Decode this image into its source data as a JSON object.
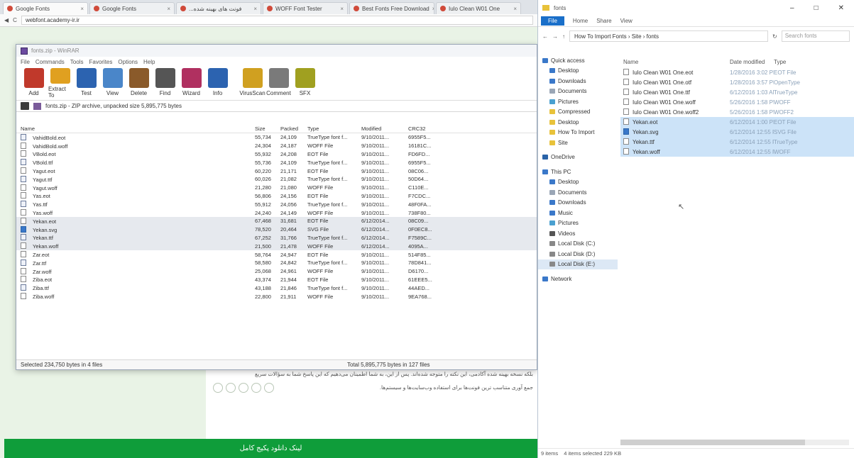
{
  "browser": {
    "tabs": [
      "Google Fonts",
      "Google Fonts",
      "...فونت های بهینه شده",
      "WOFF Font Tester",
      "Best Fonts Free Download",
      "Iulo Clean W01 One"
    ],
    "url": "webfont.academy-ir.ir",
    "rtl_line1": "بلکه نسخه بهینه شده آکادمی، این نکته را متوجه شده‌اند. پس از این، به شما اطمینان می‌دهیم که این پاسخ شما به سؤالات سریع",
    "rtl_line2": "جمع آوری متناسب ترین فونت‌ها برای استفاده وب‌سایت‌ها و سیستم‌ها.",
    "greenbar_text": "لینک دانلود پکیج کامل"
  },
  "winrar": {
    "title": "fonts.zip - WinRAR",
    "menu": [
      "File",
      "Commands",
      "Tools",
      "Favorites",
      "Options",
      "Help"
    ],
    "toolbar": [
      {
        "label": "Add",
        "icon": "add-icon",
        "color": "#c0392b"
      },
      {
        "label": "Extract To",
        "icon": "extract-icon",
        "color": "#e0a020"
      },
      {
        "label": "Test",
        "icon": "test-icon",
        "color": "#2c63b0"
      },
      {
        "label": "View",
        "icon": "view-icon",
        "color": "#4a86c9"
      },
      {
        "label": "Delete",
        "icon": "delete-icon",
        "color": "#8a5a2a"
      },
      {
        "label": "Find",
        "icon": "find-icon",
        "color": "#555555"
      },
      {
        "label": "Wizard",
        "icon": "wizard-icon",
        "color": "#b03060"
      },
      {
        "label": "Info",
        "icon": "info-icon",
        "color": "#2c63b0"
      },
      {
        "label": "VirusScan",
        "icon": "virusscan-icon",
        "color": "#d0a020"
      },
      {
        "label": "Comment",
        "icon": "comment-icon",
        "color": "#7a7a7a"
      },
      {
        "label": "SFX",
        "icon": "sfx-icon",
        "color": "#a0a020"
      }
    ],
    "path": "fonts.zip - ZIP archive, unpacked size 5,895,775 bytes",
    "columns": [
      "Name",
      "Size",
      "Packed",
      "Type",
      "Modified",
      "CRC32"
    ],
    "rows": [
      {
        "name": "VahidBold.eot",
        "size": "55,734",
        "packed": "24,109",
        "type": "TrueType font f...",
        "mod": "9/10/2011...",
        "crc": "6955F5...",
        "icon": "ttf"
      },
      {
        "name": "VahidBold.woff",
        "size": "24,304",
        "packed": "24,187",
        "type": "WOFF File",
        "mod": "9/10/2011...",
        "crc": "16181C...",
        "icon": "file"
      },
      {
        "name": "VBold.eot",
        "size": "55,932",
        "packed": "24,208",
        "type": "EOT File",
        "mod": "9/10/2011...",
        "crc": "FD6FD...",
        "icon": "file"
      },
      {
        "name": "VBold.ttf",
        "size": "55,736",
        "packed": "24,109",
        "type": "TrueType font f...",
        "mod": "9/10/2011...",
        "crc": "6955F5...",
        "icon": "ttf"
      },
      {
        "name": "Yagut.eot",
        "size": "60,220",
        "packed": "21,171",
        "type": "EOT File",
        "mod": "9/10/2011...",
        "crc": "08C06...",
        "icon": "file"
      },
      {
        "name": "Yagut.ttf",
        "size": "60,026",
        "packed": "21,082",
        "type": "TrueType font f...",
        "mod": "9/10/2011...",
        "crc": "50D64...",
        "icon": "ttf"
      },
      {
        "name": "Yagut.woff",
        "size": "21,280",
        "packed": "21,080",
        "type": "WOFF File",
        "mod": "9/10/2011...",
        "crc": "C110E...",
        "icon": "file"
      },
      {
        "name": "Yas.eot",
        "size": "56,806",
        "packed": "24,156",
        "type": "EOT File",
        "mod": "9/10/2011...",
        "crc": "F7CDC...",
        "icon": "file"
      },
      {
        "name": "Yas.ttf",
        "size": "55,912",
        "packed": "24,056",
        "type": "TrueType font f...",
        "mod": "9/10/2011...",
        "crc": "48F0FA...",
        "icon": "ttf"
      },
      {
        "name": "Yas.woff",
        "size": "24,240",
        "packed": "24,149",
        "type": "WOFF File",
        "mod": "9/10/2011...",
        "crc": "738F80...",
        "icon": "file"
      },
      {
        "name": "Yekan.eot",
        "size": "67,468",
        "packed": "31,681",
        "type": "EOT File",
        "mod": "6/12/2014...",
        "crc": "08C09...",
        "icon": "file",
        "selected": true
      },
      {
        "name": "Yekan.svg",
        "size": "78,520",
        "packed": "20,464",
        "type": "SVG File",
        "mod": "6/12/2014...",
        "crc": "0F0EC8...",
        "icon": "svg",
        "selected": true
      },
      {
        "name": "Yekan.ttf",
        "size": "67,252",
        "packed": "31,766",
        "type": "TrueType font f...",
        "mod": "6/12/2014...",
        "crc": "F7589C...",
        "icon": "ttf",
        "selected": true
      },
      {
        "name": "Yekan.woff",
        "size": "21,500",
        "packed": "21,478",
        "type": "WOFF File",
        "mod": "6/12/2014...",
        "crc": "4095A...",
        "icon": "file",
        "selected": true
      },
      {
        "name": "Zar.eot",
        "size": "58,764",
        "packed": "24,947",
        "type": "EOT File",
        "mod": "9/10/2011...",
        "crc": "514F85...",
        "icon": "file"
      },
      {
        "name": "Zar.ttf",
        "size": "58,580",
        "packed": "24,842",
        "type": "TrueType font f...",
        "mod": "9/10/2011...",
        "crc": "78D841...",
        "icon": "ttf"
      },
      {
        "name": "Zar.woff",
        "size": "25,068",
        "packed": "24,961",
        "type": "WOFF File",
        "mod": "9/10/2011...",
        "crc": "D6170...",
        "icon": "file"
      },
      {
        "name": "Ziba.eot",
        "size": "43,374",
        "packed": "21,944",
        "type": "EOT File",
        "mod": "9/10/2011...",
        "crc": "61EEE5...",
        "icon": "file"
      },
      {
        "name": "Ziba.ttf",
        "size": "43,188",
        "packed": "21,846",
        "type": "TrueType font f...",
        "mod": "9/10/2011...",
        "crc": "44AED...",
        "icon": "ttf"
      },
      {
        "name": "Ziba.woff",
        "size": "22,800",
        "packed": "21,911",
        "type": "WOFF File",
        "mod": "9/10/2011...",
        "crc": "9EA768...",
        "icon": "file"
      }
    ],
    "status_left": "Selected 234,750 bytes in 4 files",
    "status_right": "Total 5,895,775 bytes in 127 files"
  },
  "explorer": {
    "title": "fonts",
    "ribbon": [
      "File",
      "Home",
      "Share",
      "View"
    ],
    "breadcrumb": "How To Import Fonts  ›  Site  ›  fonts",
    "search_placeholder": "Search fonts",
    "nav": [
      {
        "label": "Quick access",
        "top": true,
        "color": "#3a78c9"
      },
      {
        "label": "Desktop",
        "color": "#3a78c9"
      },
      {
        "label": "Downloads",
        "color": "#3a78c9"
      },
      {
        "label": "Documents",
        "color": "#9aa6b6"
      },
      {
        "label": "Pictures",
        "color": "#4aa0d0"
      },
      {
        "label": "Compressed",
        "color": "#e8c23a"
      },
      {
        "label": "Desktop",
        "color": "#e8c23a"
      },
      {
        "label": "How To Import",
        "color": "#e8c23a"
      },
      {
        "label": "Site",
        "color": "#e8c23a"
      },
      {
        "gap": true
      },
      {
        "label": "OneDrive",
        "top": true,
        "color": "#2a63a8"
      },
      {
        "gap": true
      },
      {
        "label": "This PC",
        "top": true,
        "color": "#3a78c9"
      },
      {
        "label": "Desktop",
        "color": "#3a78c9"
      },
      {
        "label": "Documents",
        "color": "#9aa6b6"
      },
      {
        "label": "Downloads",
        "color": "#3a78c9"
      },
      {
        "label": "Music",
        "color": "#3a78c9"
      },
      {
        "label": "Pictures",
        "color": "#4aa0d0"
      },
      {
        "label": "Videos",
        "color": "#555555"
      },
      {
        "label": "Local Disk (C:)",
        "color": "#888888"
      },
      {
        "label": "Local Disk (D:)",
        "color": "#888888"
      },
      {
        "label": "Local Disk (E:)",
        "color": "#888888",
        "selected": true
      },
      {
        "gap": true
      },
      {
        "label": "Network",
        "top": true,
        "color": "#3a78c9"
      }
    ],
    "columns": [
      "Name",
      "Date modified",
      "Type"
    ],
    "files": [
      {
        "name": "Iulo Clean W01 One.eot",
        "date": "1/28/2016 3:02 PM",
        "type": "EOT File",
        "icon": "file"
      },
      {
        "name": "Iulo Clean W01 One.otf",
        "date": "1/28/2016 3:57 PM",
        "type": "OpenType",
        "icon": "file"
      },
      {
        "name": "Iulo Clean W01 One.ttf",
        "date": "6/12/2016 1:03 AM",
        "type": "TrueType",
        "icon": "file"
      },
      {
        "name": "Iulo Clean W01 One.woff",
        "date": "5/26/2016 1:58 PM",
        "type": "WOFF",
        "icon": "file"
      },
      {
        "name": "Iulo Clean W01 One.woff2",
        "date": "5/26/2016 1:58 PM",
        "type": "WOFF2",
        "icon": "file"
      },
      {
        "name": "Yekan.eot",
        "date": "6/12/2014 1:00 PM",
        "type": "EOT File",
        "icon": "file",
        "selected": true
      },
      {
        "name": "Yekan.svg",
        "date": "6/12/2014 12:55 PM",
        "type": "SVG File",
        "icon": "svg",
        "selected": true
      },
      {
        "name": "Yekan.ttf",
        "date": "6/12/2014 12:55 PM",
        "type": "TrueType",
        "icon": "file",
        "selected": true
      },
      {
        "name": "Yekan.woff",
        "date": "6/12/2014 12:55 PM",
        "type": "WOFF",
        "icon": "file",
        "selected": true
      }
    ],
    "status": [
      "9 items",
      "4 items selected 229 KB"
    ]
  }
}
